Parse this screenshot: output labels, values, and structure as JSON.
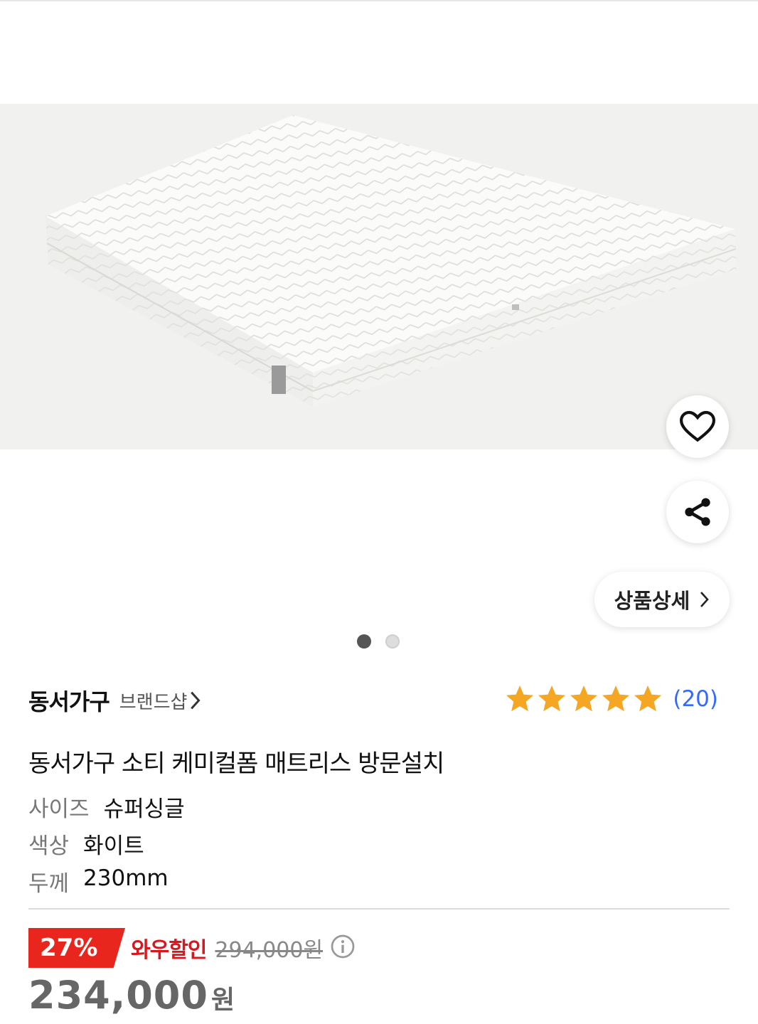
{
  "header": {
    "like_icon": "heart-outline-icon",
    "share_icon": "share-icon"
  },
  "gallery": {
    "image_alt": "mattress-product-image",
    "detail_button_label": "상품상세",
    "page_count": 2,
    "current_page": 1
  },
  "brand": {
    "name": "동서가구",
    "shop_label": "브랜드샵"
  },
  "rating": {
    "stars": 5,
    "count_label": "(20)",
    "star_color": "#f5a623"
  },
  "product": {
    "title": "동서가구 소티 케미컬폼 매트리스 방문설치",
    "specs": [
      {
        "key": "사이즈",
        "value": "슈퍼싱글"
      },
      {
        "key": "색상",
        "value": "화이트"
      },
      {
        "key": "두께",
        "value": "230mm"
      }
    ]
  },
  "price": {
    "discount_badge": "27%",
    "discount_label": "와우할인",
    "original_price": "294,000원",
    "final_price": "234,000",
    "currency": "원",
    "accent_color": "#e8261d"
  }
}
